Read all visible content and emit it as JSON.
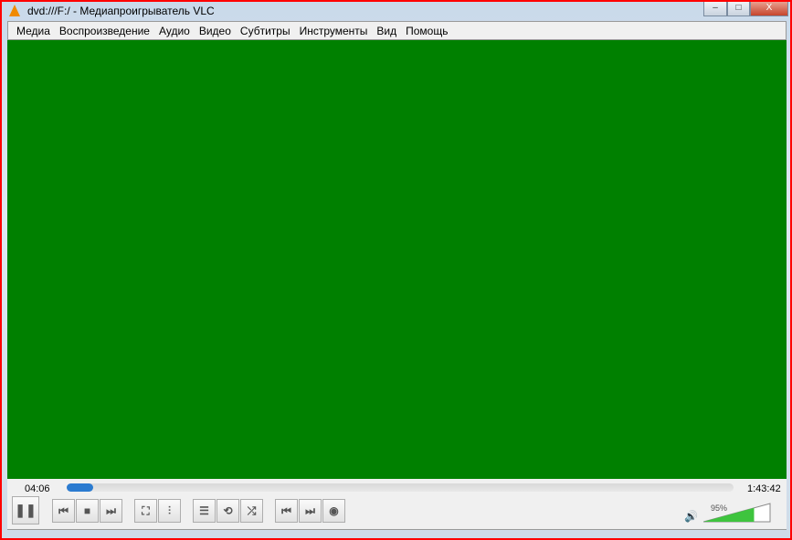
{
  "window": {
    "title": "dvd:///F:/ - Медиапроигрыватель VLC",
    "min": "–",
    "max": "□",
    "close": "X"
  },
  "menu": [
    "Медиа",
    "Воспроизведение",
    "Аудио",
    "Видео",
    "Субтитры",
    "Инструменты",
    "Вид",
    "Помощь"
  ],
  "video": {
    "color": "#008000"
  },
  "playback": {
    "elapsed": "04:06",
    "total": "1:43:42",
    "progress_percent": 4
  },
  "volume": {
    "label": "95%",
    "value_percent": 95
  },
  "buttons": {
    "pause": "❚❚",
    "prev": "⏮",
    "stop": "■",
    "next": "⏭",
    "fullscreen": "⛶",
    "extended": "⫶",
    "playlist": "☰",
    "loop": "⟲",
    "shuffle": "⤮",
    "frame_prev": "⏮",
    "frame_next": "⏭",
    "dvd_menu": "◉"
  }
}
